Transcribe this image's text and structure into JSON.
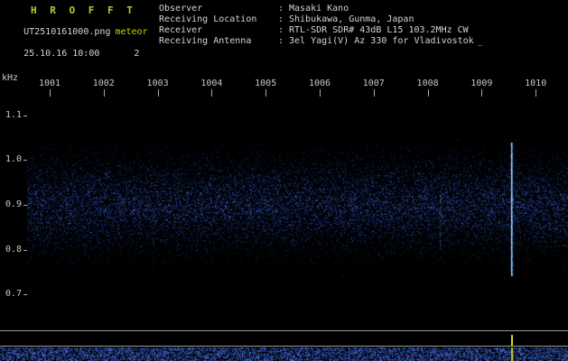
{
  "app": {
    "title": "H R O F F T",
    "filename": "UT2510161000.png",
    "observatory": "meteor",
    "timestamp": "25.10.16 10:00",
    "counter": "2",
    "cursor": "_"
  },
  "info": {
    "rows": [
      {
        "label": "Observer",
        "colon": ":",
        "value": "Masaki Kano"
      },
      {
        "label": "Receiving Location",
        "colon": ":",
        "value": "Shibukawa, Gunma, Japan"
      },
      {
        "label": "Receiver",
        "colon": ":",
        "value": "RTL-SDR SDR# 43dB L15 103.2MHz CW"
      },
      {
        "label": "Receiving Antenna",
        "colon": ":",
        "value": "3el Yagi(V) Az 330 for Vladivostok"
      }
    ]
  },
  "chart_data": {
    "type": "heatmap",
    "x_ticks": [
      "1001",
      "1002",
      "1003",
      "1004",
      "1005",
      "1006",
      "1007",
      "1008",
      "1009",
      "1010"
    ],
    "y_unit": "kHz",
    "y_ticks": [
      1.1,
      1.0,
      0.9,
      0.8,
      0.7
    ],
    "y_range_khz": [
      0.62,
      1.14
    ],
    "noise_band": {
      "center_khz": 0.9,
      "sigma_khz": 0.06
    },
    "echoes": [
      {
        "x_frac": 0.895,
        "f_lo_khz": 0.74,
        "f_hi_khz": 1.04,
        "strength": 1.0
      },
      {
        "x_frac": 0.763,
        "f_lo_khz": 0.8,
        "f_hi_khz": 0.93,
        "strength": 0.35
      }
    ],
    "signal_spike": {
      "x_frac": 0.895,
      "color": "#d8d820"
    },
    "colors": {
      "noise_low": "#000820",
      "noise_high": "#4a78ff",
      "echo_core": "#d8ffff"
    }
  }
}
